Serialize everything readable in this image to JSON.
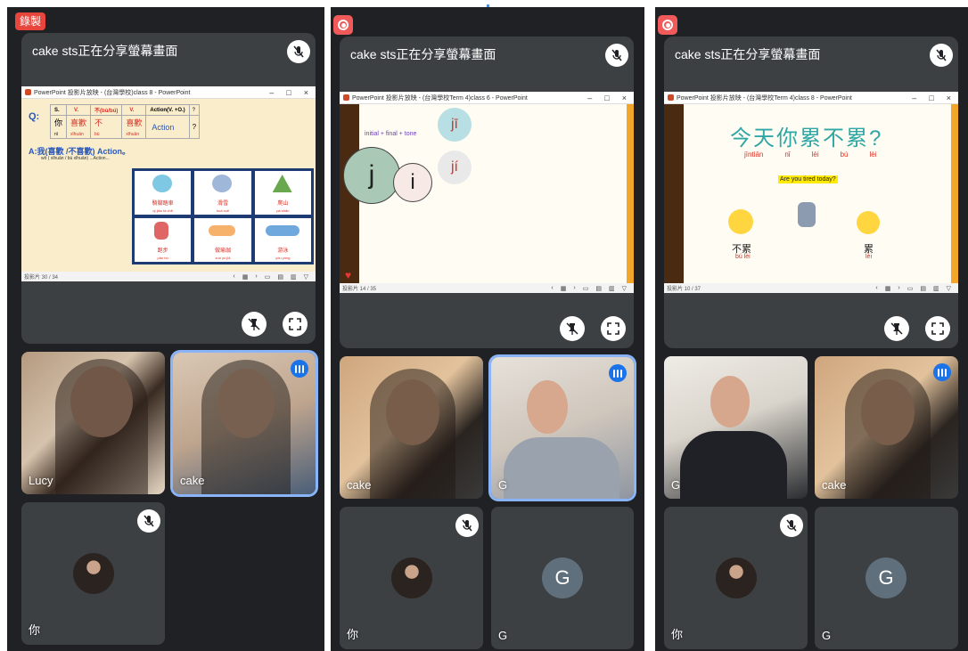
{
  "recording_label": "錄製",
  "panels": [
    {
      "presenter_title": "cake sts正在分享螢幕畫面",
      "slide": {
        "window_title": "PowerPoint 投影片放映 - (台灣學校)class 8 - PowerPoint",
        "status": "投影片 30 / 34",
        "q_label": "Q:",
        "table_headers": [
          "S.",
          "V.",
          "不(bù/bú)",
          "V.",
          "Action(V. +O.)",
          "?"
        ],
        "table_chars": [
          "你",
          "喜歡",
          "不",
          "喜歡",
          "Action",
          "?"
        ],
        "table_pinyin": [
          "nǐ",
          "xǐhuān",
          "bù",
          "xǐhuān",
          "",
          ""
        ],
        "answer_line": "A:我(喜歡 /不喜歡) Action。",
        "answer_pinyin": "wǒ ( xǐhuān / bù xǐhuān) ...Action...",
        "cards": [
          {
            "label": "騎腳踏車",
            "pinyin": "qí jiǎo tà chē"
          },
          {
            "label": "滑雪",
            "pinyin": "huá xuě"
          },
          {
            "label": "爬山",
            "pinyin": "pá shān"
          },
          {
            "label": "跑步",
            "pinyin": "pǎo bù"
          },
          {
            "label": "做瑜珈",
            "pinyin": "zuò yú jiā"
          },
          {
            "label": "游泳",
            "pinyin": "yóu yǒng"
          }
        ]
      },
      "videos": [
        {
          "name": "Lucy",
          "speaking": false
        },
        {
          "name": "cake",
          "speaking": true
        }
      ],
      "self_name": "你"
    },
    {
      "presenter_title": "cake sts正在分享螢幕畫面",
      "slide": {
        "window_title": "PowerPoint 投影片放映 - (台灣學校Term 4)class 6 - PowerPoint",
        "status": "投影片 14 / 35",
        "tone_text": "initial + final + tone",
        "big_initial": "j",
        "big_final": "i",
        "syllable_1": "jī",
        "syllable_2": "jí"
      },
      "videos": [
        {
          "name": "cake",
          "speaking": false
        },
        {
          "name": "G",
          "speaking": true
        }
      ],
      "self_name": "你",
      "other_name": "G",
      "other_initial": "G"
    },
    {
      "presenter_title": "cake sts正在分享螢幕畫面",
      "slide": {
        "window_title": "PowerPoint 投影片放映 - (台灣學校Term 4)class 8 - PowerPoint",
        "status": "投影片 10 / 37",
        "big_question": "今天你累不累?",
        "pinyin": [
          "jīntiān",
          "nǐ",
          "lèi",
          "bú",
          "lèi"
        ],
        "english": "Are you tired today?",
        "left_answer": "不累",
        "left_answer_pinyin": "bú lèi",
        "right_answer": "累",
        "right_answer_pinyin": "lèi"
      },
      "videos": [
        {
          "name": "G",
          "speaking": false
        },
        {
          "name": "cake",
          "speaking": true
        }
      ],
      "self_name": "你",
      "other_name": "G",
      "other_initial": "G"
    }
  ],
  "colors": {
    "meet_bg": "#202124",
    "tile_bg": "#3c4043",
    "speaking_outline": "#8ab4f8",
    "speaking_badge": "#1a73e8",
    "record_red": "#e8453c",
    "pinyin_red": "#d93025",
    "teal_text": "#2fa7a5"
  }
}
